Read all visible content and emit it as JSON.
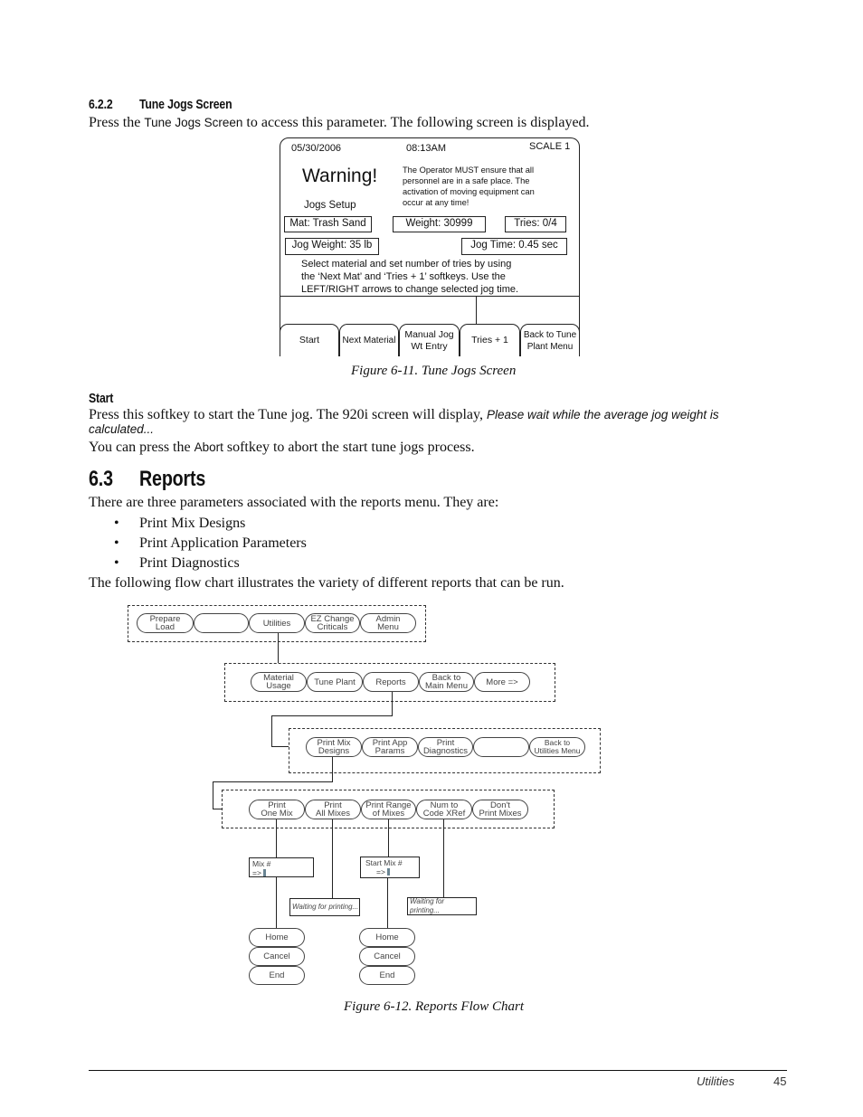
{
  "section_622": {
    "number": "6.2.2",
    "title": "Tune Jogs Screen",
    "intro_prefix": "Press the ",
    "intro_key": "Tune Jogs Screen",
    "intro_suffix": " to access this parameter. The following screen is displayed."
  },
  "tune_jogs_screen": {
    "date": "05/30/2006",
    "time": "08:13AM",
    "scale": "SCALE 1",
    "warning_title": "Warning!",
    "subtitle": "Jogs Setup",
    "warning_lines": [
      "The Operator MUST ensure that all",
      "personnel are in a safe place. The",
      "activation of moving equipment can",
      "occur at any time!"
    ],
    "material": "Mat: Trash Sand",
    "weight": "Weight: 30999",
    "tries": "Tries: 0/4",
    "jog_weight": "Jog Weight: 35 lb",
    "jog_time": "Jog Time: 0.45 sec",
    "instructions": [
      "Select material and set number of tries by using",
      "the ‘Next Mat’ and ‘Tries + 1’ softkeys. Use the",
      "LEFT/RIGHT arrows to change selected jog time."
    ],
    "softkeys": [
      {
        "line1": "Start",
        "line2": ""
      },
      {
        "line1": "Next Material",
        "line2": ""
      },
      {
        "line1": "Manual Jog",
        "line2": "Wt Entry"
      },
      {
        "line1": "Tries + 1",
        "line2": ""
      },
      {
        "line1": "Back to Tune",
        "line2": "Plant Menu"
      }
    ]
  },
  "figure_611_caption": "Figure 6-11. Tune Jogs Screen",
  "start_section": {
    "heading": "Start",
    "line1_prefix": "Press this softkey to start the Tune jog. The 920i screen will display, ",
    "line1_italic": "Please wait while the average jog weight is",
    "line2_italic": "calculated...",
    "abort_prefix": "You can press the ",
    "abort_key": "Abort",
    "abort_suffix": " softkey to abort the start tune jogs process."
  },
  "section_63": {
    "number": "6.3",
    "title": "Reports",
    "intro": "There are three parameters associated with the reports menu. They are:",
    "bullets": [
      "Print Mix Designs",
      "Print Application Parameters",
      "Print Diagnostics"
    ],
    "flow_intro": "The following flow chart illustrates the variety of different reports that can be run."
  },
  "flowchart": {
    "level1": [
      "Prepare\nLoad",
      "",
      "Utilities",
      "EZ Change\nCriticals",
      "Admin\nMenu"
    ],
    "level2": [
      "Material\nUsage",
      "Tune Plant",
      "Reports",
      "Back to\nMain Menu",
      "More =>"
    ],
    "level3": [
      "Print Mix\nDesigns",
      "Print App\nParams",
      "Print\nDiagnostics",
      "",
      "Back to\nUtilities Menu"
    ],
    "level4": [
      "Print\nOne Mix",
      "Print\nAll Mixes",
      "Print Range\nof Mixes",
      "Num to\nCode XRef",
      "Don't\nPrint Mixes"
    ],
    "mix_prompt": {
      "label": "Mix #",
      "arrow": "=>"
    },
    "start_mix_prompt": {
      "label": "Start Mix #",
      "arrow": "=>"
    },
    "waiting_text": "Waiting for printing...",
    "exit_buttons": [
      "Home",
      "Cancel",
      "End"
    ],
    "cursor_color": "#6a8593"
  },
  "figure_612_caption": "Figure 6-12. Reports Flow Chart",
  "footer": {
    "section": "Utilities",
    "page": "45"
  }
}
